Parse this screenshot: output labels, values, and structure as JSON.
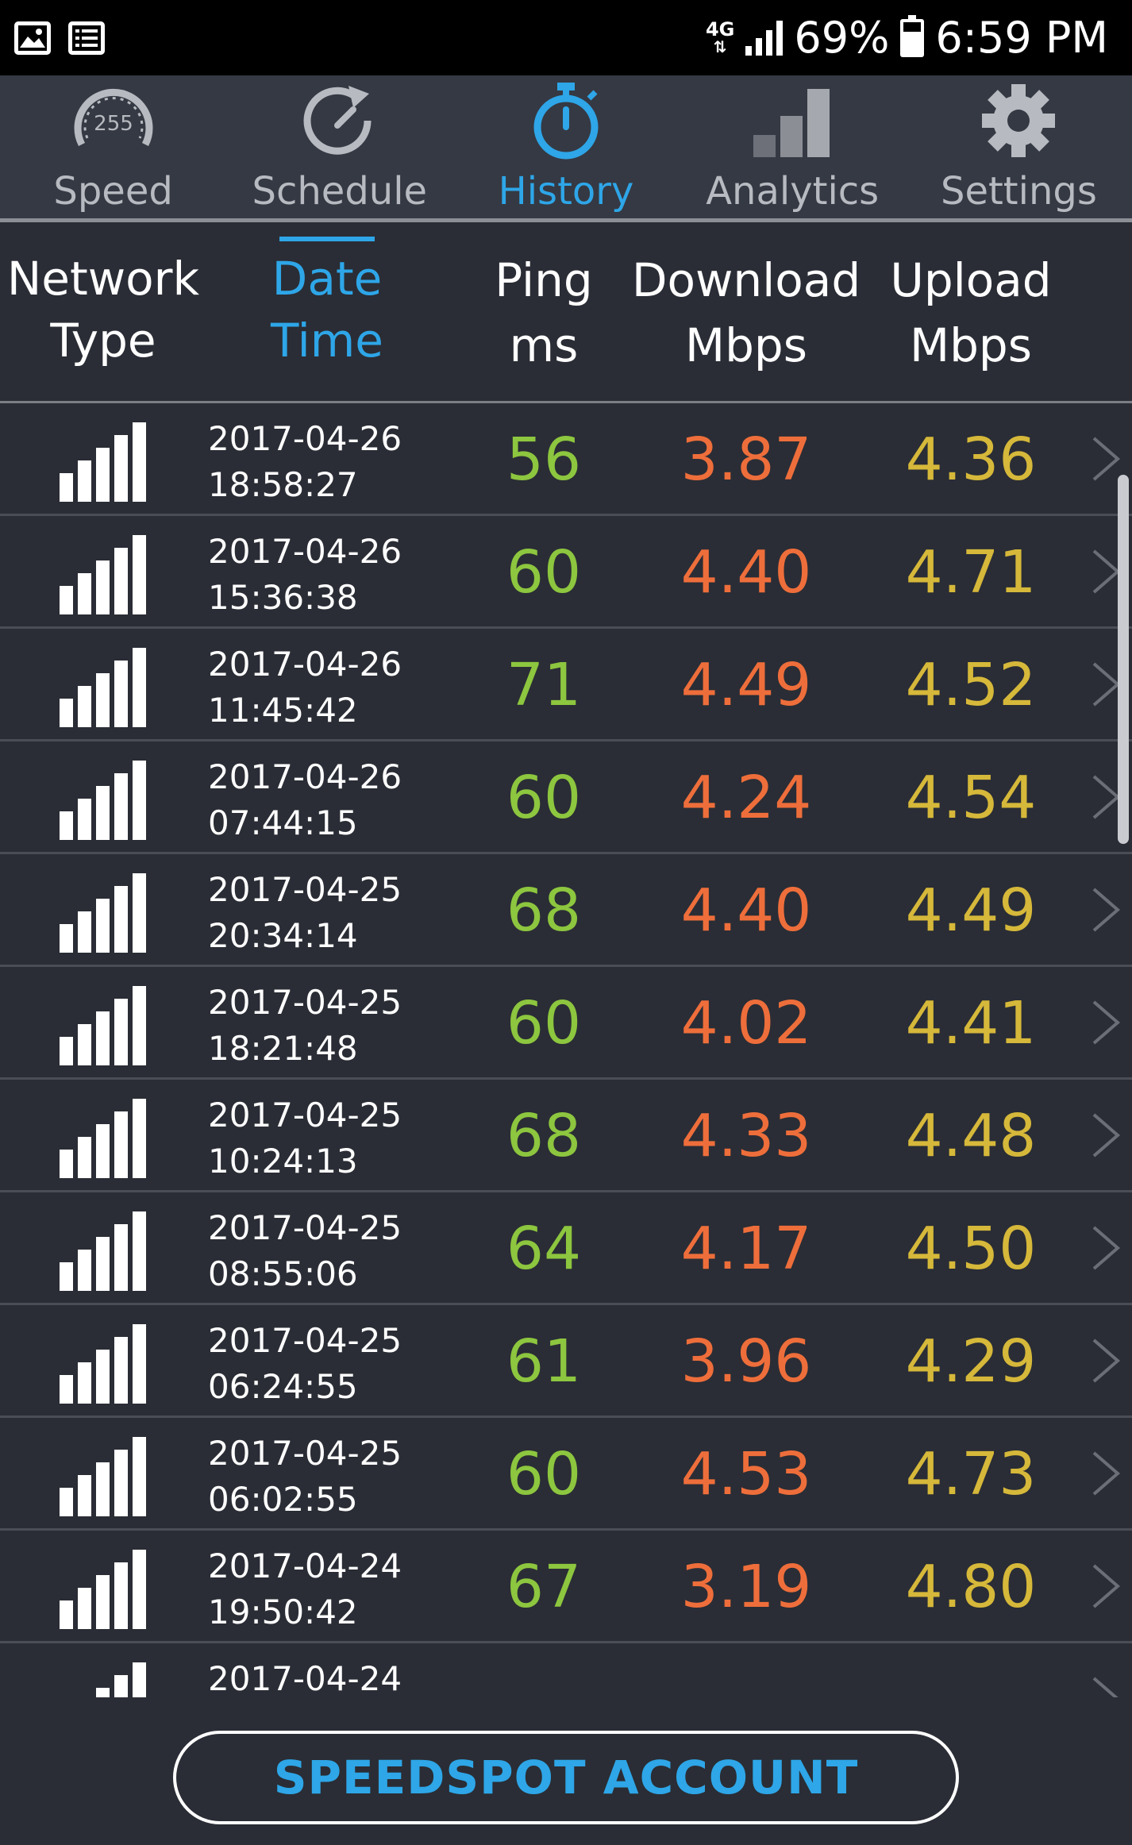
{
  "status_bar": {
    "network": "4G",
    "battery": "69%",
    "time": "6:59 PM"
  },
  "tabs": [
    {
      "label": "Speed",
      "icon": "speedometer-icon",
      "active": false
    },
    {
      "label": "Schedule",
      "icon": "schedule-icon",
      "active": false
    },
    {
      "label": "History",
      "icon": "stopwatch-icon",
      "active": true
    },
    {
      "label": "Analytics",
      "icon": "bar-chart-icon",
      "active": false
    },
    {
      "label": "Settings",
      "icon": "gear-icon",
      "active": false
    }
  ],
  "speed_gauge_value": "255",
  "columns": {
    "network_1": "Network",
    "network_2": "Type",
    "date_1": "Date",
    "time_1": "Time",
    "ping_1": "Ping",
    "ping_2": "ms",
    "download_1": "Download",
    "download_2": "Mbps",
    "upload_1": "Upload",
    "upload_2": "Mbps"
  },
  "rows": [
    {
      "date": "2017-04-26",
      "time": "18:58:27",
      "ping": "56",
      "download": "3.87",
      "upload": "4.36"
    },
    {
      "date": "2017-04-26",
      "time": "15:36:38",
      "ping": "60",
      "download": "4.40",
      "upload": "4.71"
    },
    {
      "date": "2017-04-26",
      "time": "11:45:42",
      "ping": "71",
      "download": "4.49",
      "upload": "4.52"
    },
    {
      "date": "2017-04-26",
      "time": "07:44:15",
      "ping": "60",
      "download": "4.24",
      "upload": "4.54"
    },
    {
      "date": "2017-04-25",
      "time": "20:34:14",
      "ping": "68",
      "download": "4.40",
      "upload": "4.49"
    },
    {
      "date": "2017-04-25",
      "time": "18:21:48",
      "ping": "60",
      "download": "4.02",
      "upload": "4.41"
    },
    {
      "date": "2017-04-25",
      "time": "10:24:13",
      "ping": "68",
      "download": "4.33",
      "upload": "4.48"
    },
    {
      "date": "2017-04-25",
      "time": "08:55:06",
      "ping": "64",
      "download": "4.17",
      "upload": "4.50"
    },
    {
      "date": "2017-04-25",
      "time": "06:24:55",
      "ping": "61",
      "download": "3.96",
      "upload": "4.29"
    },
    {
      "date": "2017-04-25",
      "time": "06:02:55",
      "ping": "60",
      "download": "4.53",
      "upload": "4.73"
    },
    {
      "date": "2017-04-24",
      "time": "19:50:42",
      "ping": "67",
      "download": "3.19",
      "upload": "4.80"
    },
    {
      "date": "2017-04-24",
      "time": "",
      "ping": "",
      "download": "",
      "upload": ""
    }
  ],
  "account_button": "SPEEDSPOT ACCOUNT",
  "colors": {
    "accent": "#2ea6e8",
    "ping": "#8dc63f",
    "download": "#ee6e3b",
    "upload": "#d6b83a",
    "background": "#2a2d35"
  }
}
